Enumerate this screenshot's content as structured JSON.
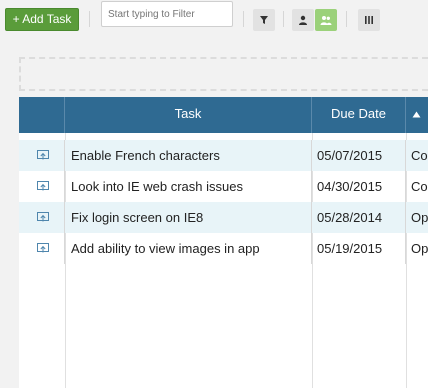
{
  "toolbar": {
    "add_task_label": "+ Add Task",
    "filter_placeholder": "Start typing to Filter"
  },
  "grid": {
    "columns": [
      "",
      "Task",
      "Due Date",
      ""
    ],
    "rows": [
      {
        "task": "Enable French characters",
        "due": "05/07/2015",
        "status": "Co"
      },
      {
        "task": "Look into IE web crash issues",
        "due": "04/30/2015",
        "status": "Co"
      },
      {
        "task": "Fix login screen on IE8",
        "due": "05/28/2014",
        "status": "Op"
      },
      {
        "task": "Add ability to view images in app",
        "due": "05/19/2015",
        "status": "Op"
      }
    ]
  },
  "colors": {
    "header_bg": "#2f6a92",
    "add_button": "#5a9c3a",
    "active_toggle": "#9bd17a",
    "row_alt": "#e8f4f8"
  }
}
